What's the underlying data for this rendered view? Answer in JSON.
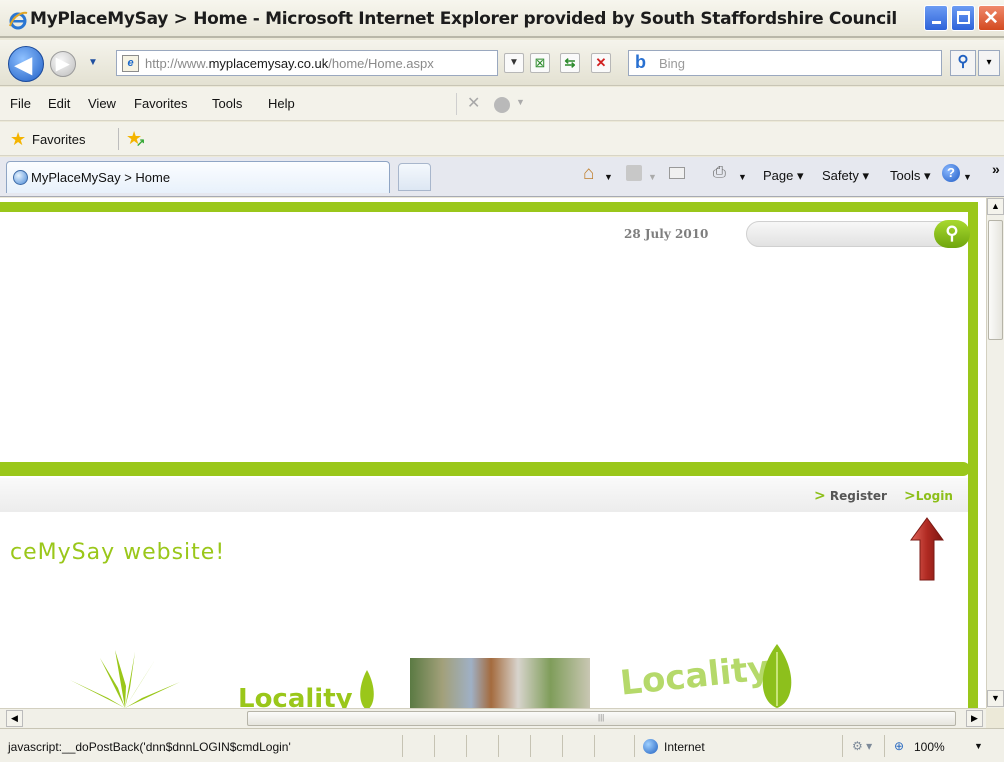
{
  "window": {
    "title": "MyPlaceMySay > Home - Microsoft Internet Explorer provided by South Staffordshire Council"
  },
  "address_bar": {
    "url_prefix": "http://www.",
    "url_domain": "myplacemysay.co.uk",
    "url_path": "/home/Home.aspx",
    "search_placeholder": "Bing"
  },
  "menu": {
    "items": [
      "File",
      "Edit",
      "View",
      "Favorites",
      "Tools",
      "Help"
    ]
  },
  "favorites_bar": {
    "label": "Favorites"
  },
  "tabs": {
    "active_label": "MyPlaceMySay > Home"
  },
  "command_bar": {
    "page": "Page ▾",
    "safety": "Safety ▾",
    "tools": "Tools ▾",
    "more": "»"
  },
  "page": {
    "date": "28 July 2010",
    "register": "Register",
    "login": "Login",
    "welcome_partial": "ceMySay website!",
    "locality_small": "Locality",
    "locality_large": "Locality",
    "colors": {
      "accent_green": "#9ac71a",
      "annotation_red": "#b02a22"
    }
  },
  "status_bar": {
    "text": "javascript:__doPostBack('dnn$dnnLOGIN$cmdLogin'",
    "zone": "Internet",
    "zoom": "100%"
  }
}
